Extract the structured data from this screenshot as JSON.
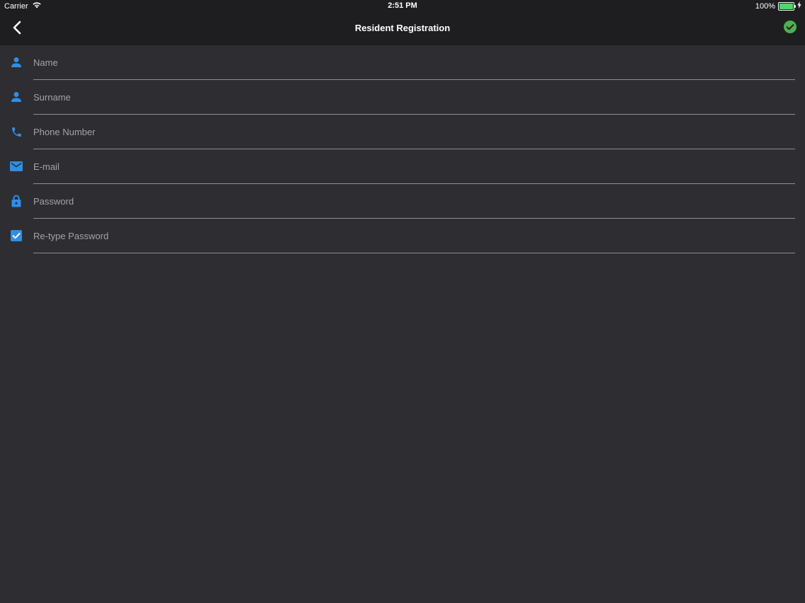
{
  "status_bar": {
    "carrier": "Carrier",
    "time": "2:51 PM",
    "battery": "100%",
    "battery_level": 1.0
  },
  "nav": {
    "title": "Resident Registration",
    "back_icon": "chevron-left-icon",
    "confirm_icon": "check-circle-icon"
  },
  "form": {
    "fields": [
      {
        "placeholder": "Name",
        "value": "",
        "icon": "person-icon",
        "type": "text"
      },
      {
        "placeholder": "Surname",
        "value": "",
        "icon": "person-icon",
        "type": "text"
      },
      {
        "placeholder": "Phone Number",
        "value": "",
        "icon": "phone-icon",
        "type": "tel"
      },
      {
        "placeholder": "E-mail",
        "value": "",
        "icon": "mail-icon",
        "type": "email"
      },
      {
        "placeholder": "Password",
        "value": "",
        "icon": "lock-icon",
        "type": "password"
      },
      {
        "placeholder": "Re-type Password",
        "value": "",
        "icon": "checkbox-icon",
        "type": "password"
      }
    ]
  },
  "colors": {
    "background": "#2e2d31",
    "bar_background": "#1e1e20",
    "accent_blue": "#2e8fe6",
    "confirm_green": "#4cb050",
    "divider": "#8e8e93",
    "placeholder": "#a3a3a8",
    "battery_green": "#4cd964"
  }
}
